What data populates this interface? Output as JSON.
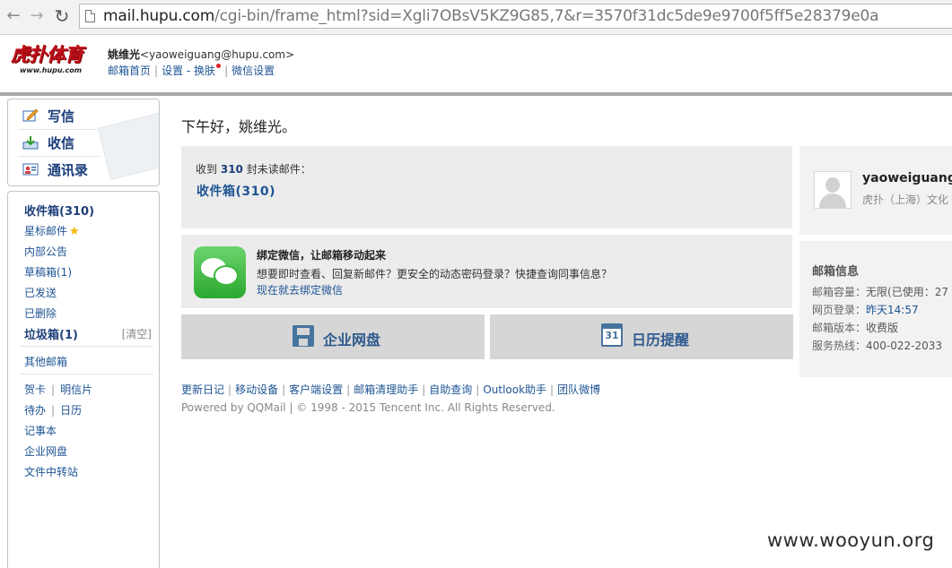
{
  "browser": {
    "url_host": "mail.hupu.com",
    "url_rest": "/cgi-bin/frame_html?sid=Xgli7OBsV5KZ9G85,7&r=3570f31dc5de9e9700f5ff5e28379e0a"
  },
  "header": {
    "logo_text": "虎扑体育",
    "logo_sub": "www.hupu.com",
    "user_name": "姚维光",
    "user_email": "<yaoweiguang@hupu.com>",
    "links": [
      "邮箱首页",
      "设置",
      "换肤",
      "微信设置"
    ]
  },
  "quick_actions": [
    {
      "label": "写信",
      "icon": "compose-icon"
    },
    {
      "label": "收信",
      "icon": "receive-icon"
    },
    {
      "label": "通讯录",
      "icon": "contacts-icon"
    }
  ],
  "folders": {
    "inbox": "收件箱(310)",
    "starred": "星标邮件",
    "notices": "内部公告",
    "drafts": "草稿箱(1)",
    "sent": "已发送",
    "deleted": "已删除",
    "spam": "垃圾箱(1)",
    "spam_clear": "[清空]",
    "other": "其他邮箱",
    "card": "贺卡",
    "postcard": "明信片",
    "todo": "待办",
    "calendar": "日历",
    "notes": "记事本",
    "netdisk": "企业网盘",
    "transfer": "文件中转站"
  },
  "main": {
    "greeting": "下午好，姚维光。",
    "unread_prefix": "收到",
    "unread_count": "310",
    "unread_suffix": "封未读邮件：",
    "inbox_link": "收件箱(310)",
    "wechat_title": "绑定微信，让邮箱移动起来",
    "wechat_desc": "想要即时查看、回复新邮件？更安全的动态密码登录？快捷查询同事信息？",
    "wechat_link": "现在就去绑定微信",
    "tile_disk": "企业网盘",
    "tile_calendar": "日历提醒",
    "calendar_day": "31",
    "footer_links": [
      "更新日记",
      "移动设备",
      "客户端设置",
      "邮箱清理助手",
      "自助查询",
      "Outlook助手",
      "团队微博"
    ],
    "copyright": "Powered by QQMail  | © 1998 - 2015 Tencent Inc. All Rights Reserved."
  },
  "profile": {
    "name": "yaoweiguang",
    "org": "虎扑（上海）文化"
  },
  "mail_info": {
    "title": "邮箱信息",
    "rows": [
      {
        "label": "邮箱容量：",
        "value": "无限(已使用：27"
      },
      {
        "label": "网页登录：",
        "value": "昨天14:57"
      },
      {
        "label": "邮箱版本：",
        "value": "收费版"
      },
      {
        "label": "服务热线：",
        "value": "400-022-2033"
      }
    ]
  },
  "watermark": "www.wooyun.org",
  "colors": {
    "link_blue": "#1e5494",
    "panel_gray": "#ececec",
    "tile_gray": "#d6d6d6",
    "brand_red": "#c0101a"
  }
}
